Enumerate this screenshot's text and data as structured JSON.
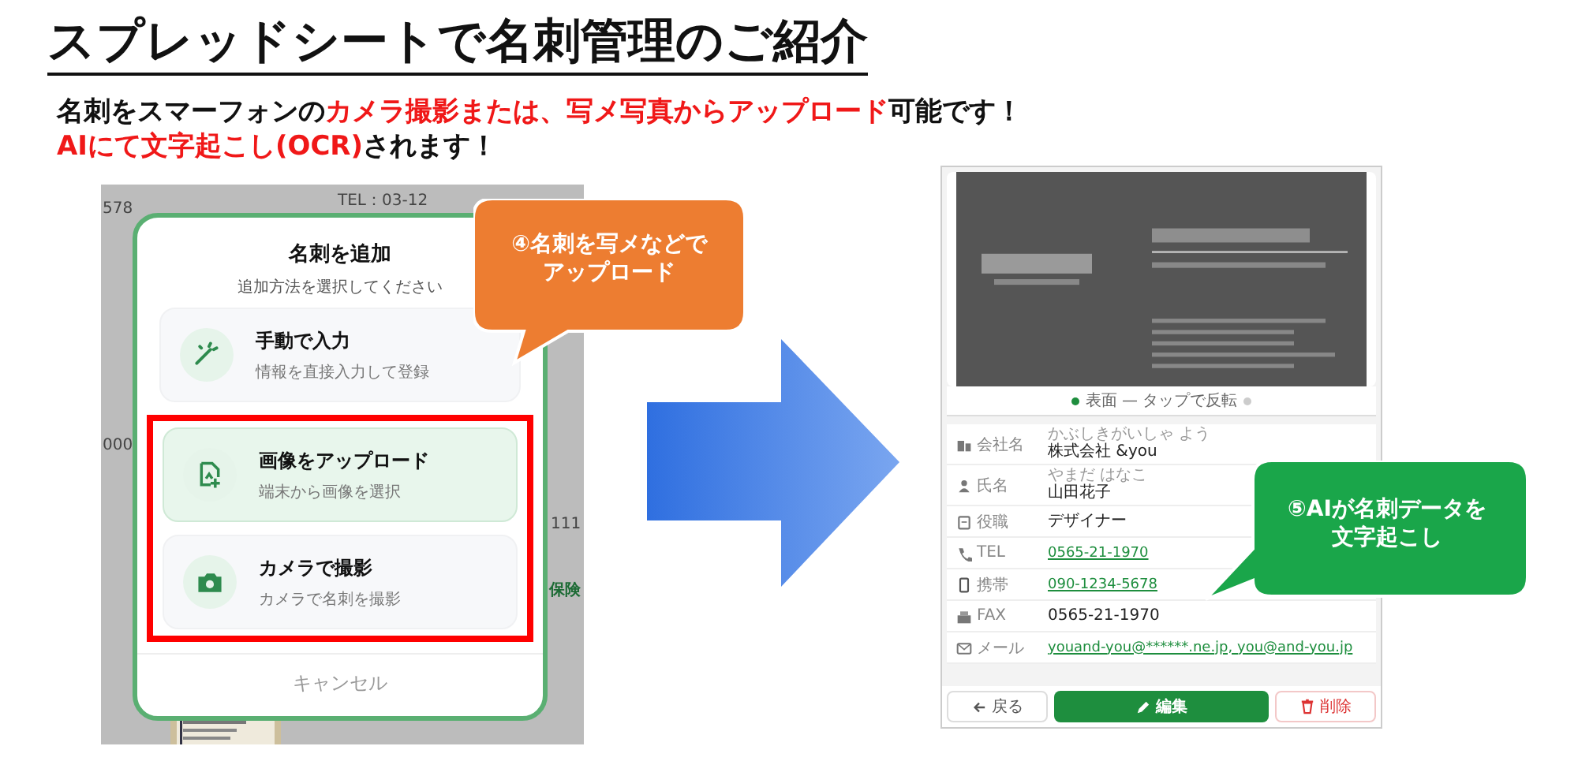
{
  "title": "スプレッドシートで名刺管理のご紹介",
  "intro": [
    [
      {
        "text": "名刺をスマーフォンの",
        "emphasis": false
      },
      {
        "text": "カメラ撮影または、写メ写真からアップロード",
        "emphasis": true
      },
      {
        "text": "可能です！",
        "emphasis": false
      }
    ],
    [
      {
        "text": "AIにて文字起こし(OCR)",
        "emphasis": true
      },
      {
        "text": "されます！",
        "emphasis": false
      }
    ]
  ],
  "left_screen": {
    "backdrop_texts": [
      "578",
      "TEL：03-12",
      "000",
      "111",
      "保険"
    ],
    "dialog": {
      "title": "名刺を追加",
      "subtitle": "追加方法を選択してください",
      "options": [
        {
          "title": "手動で入力",
          "subtitle": "情報を直接入力して登録",
          "selected": false,
          "highlighted": false
        },
        {
          "title": "画像をアップロード",
          "subtitle": "端末から画像を選択",
          "selected": true,
          "highlighted": true
        },
        {
          "title": "カメラで撮影",
          "subtitle": "カメラで名刺を撮影",
          "selected": false,
          "highlighted": true
        }
      ],
      "cancel": "キャンセル"
    }
  },
  "callouts": [
    {
      "lines": [
        "④名刺を写メなどで",
        "アップロード"
      ],
      "color": "#ed7d31"
    },
    {
      "lines": [
        "⑤AIが名刺データを",
        "文字起こし"
      ],
      "color": "#1aa64a"
    }
  ],
  "right_screen": {
    "flip_hint": "表面 — タップで反転",
    "fields": [
      {
        "label": "会社名",
        "reading": "かぶしきがいしゃ よう",
        "value": "株式会社 &you",
        "link": false
      },
      {
        "label": "氏名",
        "reading": "やまだ はなこ",
        "value": "山田花子",
        "link": false
      },
      {
        "label": "役職",
        "value": "デザイナー",
        "link": false
      },
      {
        "label": "TEL",
        "value": "0565-21-1970",
        "link": true
      },
      {
        "label": "携帯",
        "value": "090-1234-5678",
        "link": true
      },
      {
        "label": "FAX",
        "value": "0565-21-1970",
        "link": false
      },
      {
        "label": "メール",
        "value": "youand-you@******.ne.jp, you@and-you.jp",
        "link": true
      }
    ],
    "buttons": [
      {
        "label": "戻る",
        "kind": "back"
      },
      {
        "label": "編集",
        "kind": "primary"
      },
      {
        "label": "削除",
        "kind": "danger"
      }
    ]
  }
}
